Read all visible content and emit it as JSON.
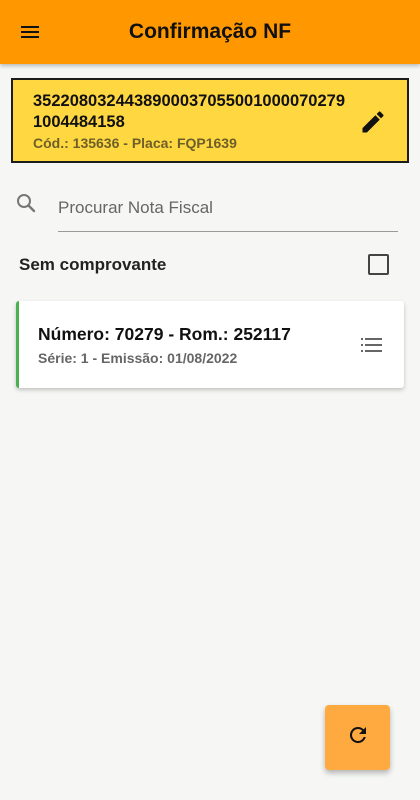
{
  "appbar": {
    "title": "Confirmação NF",
    "menu_icon": "menu-icon",
    "color": "#ff9800"
  },
  "nf_header": {
    "key": "35220803244389000370550010000702791004484158",
    "subtitle": "Cód.: 135636 - Placa: FQP1639",
    "edit_icon": "edit-icon",
    "color": "#ffd740"
  },
  "search": {
    "placeholder": "Procurar Nota Fiscal",
    "value": "",
    "icon": "search-icon"
  },
  "filter": {
    "label": "Sem comprovante",
    "checked": false
  },
  "invoices": [
    {
      "title": "Número: 70279 - Rom.: 252117",
      "subtitle": "Série: 1 - Emissão: 01/08/2022",
      "status_color": "#4caf50",
      "icon": "list-icon"
    }
  ],
  "fab": {
    "icon": "refresh-icon",
    "color": "#ffaa40"
  }
}
